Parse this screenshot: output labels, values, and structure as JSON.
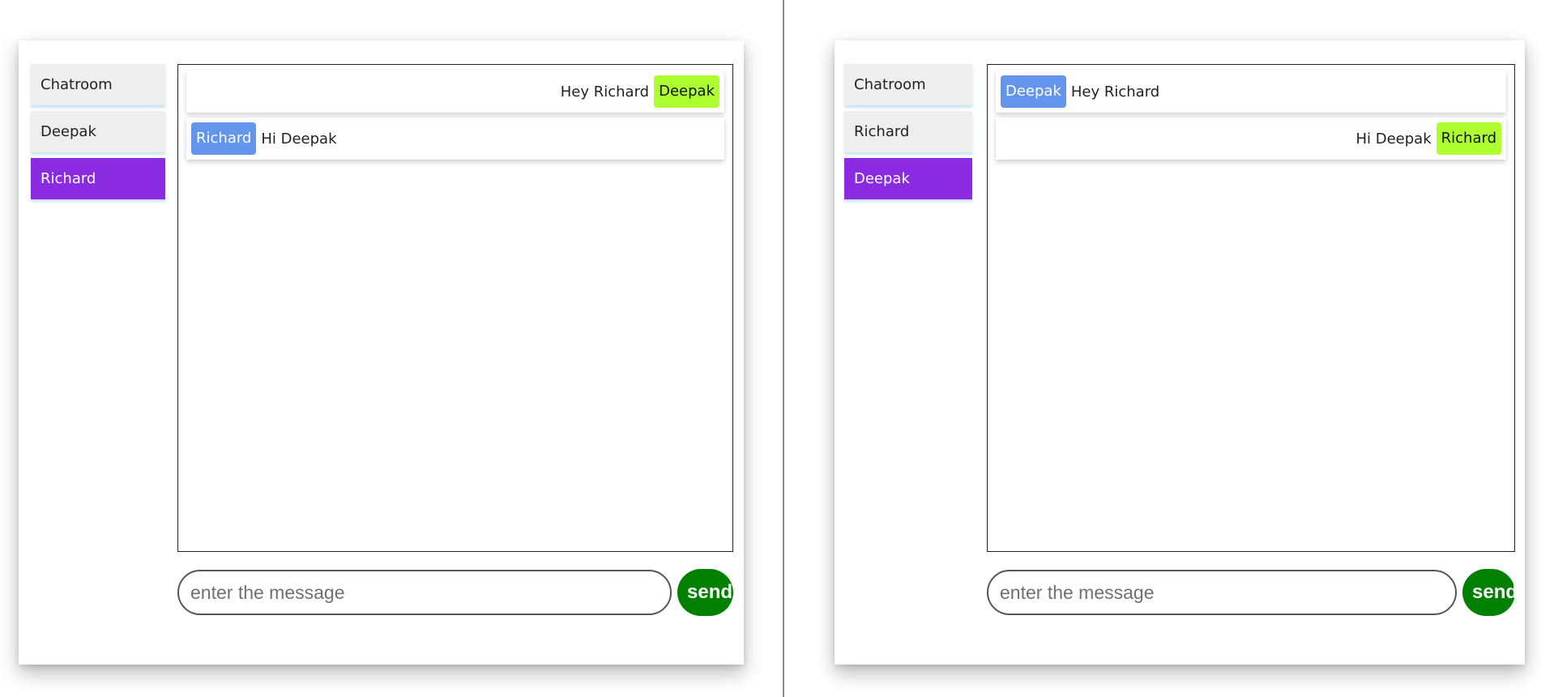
{
  "left_window": {
    "sidebar": {
      "items": [
        {
          "label": "Chatroom",
          "active": false
        },
        {
          "label": "Deepak",
          "active": false
        },
        {
          "label": "Richard",
          "active": true
        }
      ]
    },
    "messages": [
      {
        "direction": "sent",
        "text": "Hey Richard",
        "sender": "Deepak"
      },
      {
        "direction": "received",
        "text": "Hi Deepak",
        "sender": "Richard"
      }
    ],
    "composer": {
      "placeholder": "enter the message",
      "value": "",
      "send_label": "send"
    }
  },
  "right_window": {
    "sidebar": {
      "items": [
        {
          "label": "Chatroom",
          "active": false
        },
        {
          "label": "Richard",
          "active": false
        },
        {
          "label": "Deepak",
          "active": true
        }
      ]
    },
    "messages": [
      {
        "direction": "received",
        "text": "Hey Richard",
        "sender": "Deepak"
      },
      {
        "direction": "sent",
        "text": "Hi Deepak",
        "sender": "Richard"
      }
    ],
    "composer": {
      "placeholder": "enter the message",
      "value": "",
      "send_label": "send"
    }
  },
  "colors": {
    "active_item": "#8a2be2",
    "self_badge": "#adff2f",
    "other_badge": "#6495ed",
    "send_button": "#008000"
  }
}
